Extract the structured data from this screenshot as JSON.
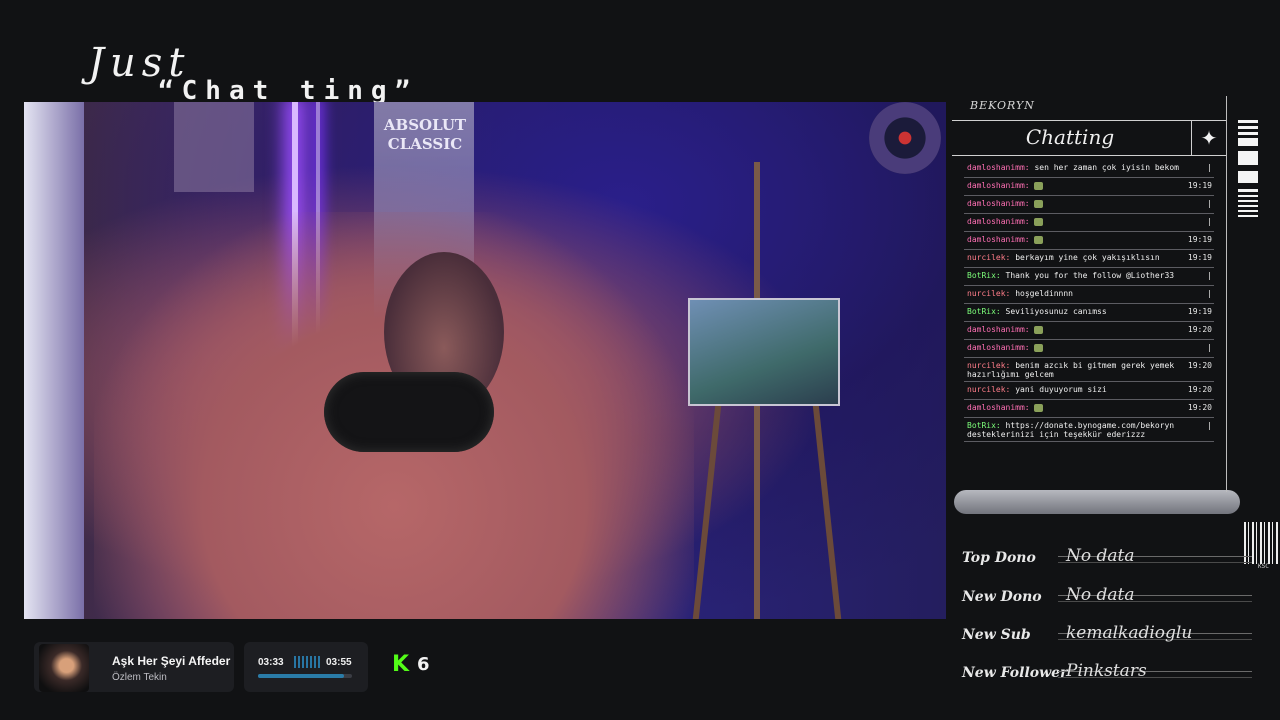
{
  "overlay": {
    "title_line1": "Just",
    "title_line2": "“Chat ting”"
  },
  "video": {
    "poster_text": "ABSOLUT\nCLASSIC"
  },
  "chat": {
    "owner": "BEKORYN",
    "header_label": "Chatting",
    "messages": [
      {
        "user": "damloshanimm:",
        "text": "sen her zaman çok iyisin bekom",
        "time": "|",
        "type": "user"
      },
      {
        "user": "damloshanimm:",
        "text": "",
        "emote": true,
        "time": "19:19",
        "type": "user"
      },
      {
        "user": "damloshanimm:",
        "text": "",
        "emote": true,
        "time": "|",
        "type": "user"
      },
      {
        "user": "damloshanimm:",
        "text": "",
        "emote": true,
        "time": "|",
        "type": "user"
      },
      {
        "user": "damloshanimm:",
        "text": "",
        "emote": true,
        "time": "19:19",
        "type": "user"
      },
      {
        "user": "nurcilek:",
        "text": "berkayım yine çok yakışıklısın",
        "time": "19:19",
        "type": "nurc"
      },
      {
        "user": "BotRix:",
        "text": "Thank you for the follow @Liother33",
        "time": "|",
        "type": "bot"
      },
      {
        "user": "nurcilek:",
        "text": "hoşgeldinnnn",
        "time": "|",
        "type": "nurc"
      },
      {
        "user": "BotRix:",
        "text": "Seviliyosunuz canımss",
        "time": "19:19",
        "type": "bot"
      },
      {
        "user": "damloshanimm:",
        "text": "",
        "emote": true,
        "time": "19:20",
        "type": "user"
      },
      {
        "user": "damloshanimm:",
        "text": "",
        "emote": true,
        "time": "|",
        "type": "user"
      },
      {
        "user": "nurcilek:",
        "text": "benim azcık bi gitmem gerek yemek hazırlığımı gelcem",
        "time": "19:20",
        "type": "nurc"
      },
      {
        "user": "nurcilek:",
        "text": "yani duyuyorum sizi",
        "time": "19:20",
        "type": "nurc"
      },
      {
        "user": "damloshanimm:",
        "text": "",
        "emote": true,
        "time": "19:20",
        "type": "user"
      },
      {
        "user": "BotRix:",
        "text": "https://donate.bynogame.com/bekoryn desteklerinizi için teşekkür ederizzz",
        "time": "|",
        "type": "bot"
      }
    ]
  },
  "stats": [
    {
      "key": "Top Dono",
      "value": "No data"
    },
    {
      "key": "New Dono",
      "value": "No data"
    },
    {
      "key": "New Sub",
      "value": "kemalkadioglu"
    },
    {
      "key": "New Follower",
      "value": "Pinkstars"
    }
  ],
  "barcode_label": "KSC",
  "music": {
    "song": "Aşk Her Şeyi Affeder",
    "artist": "Özlem Tekin",
    "elapsed": "03:33",
    "duration": "03:55",
    "progress_fraction": 0.91
  },
  "kick": {
    "logo": "K",
    "viewers": "6",
    "brand_color": "#53fc18"
  }
}
